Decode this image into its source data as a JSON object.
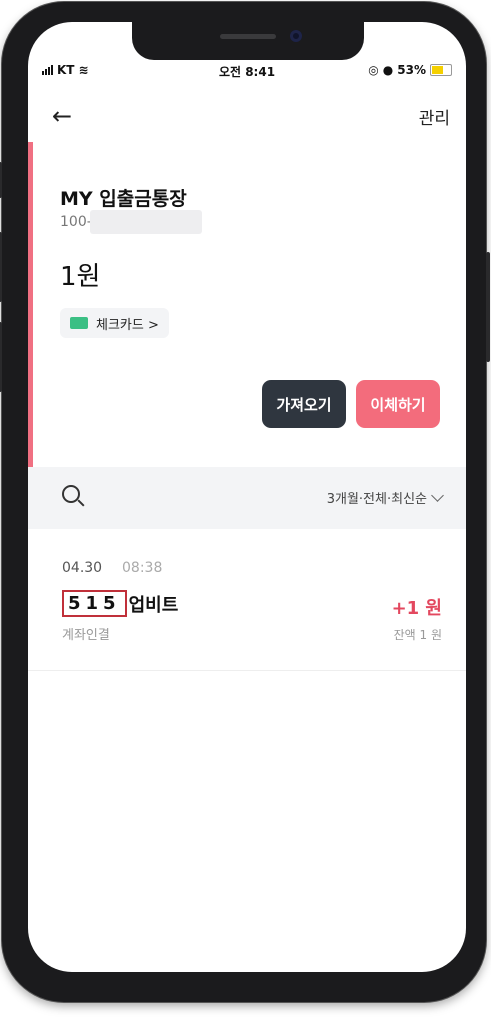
{
  "status": {
    "carrier": "KT",
    "time": "오전 8:41",
    "battery": "53%"
  },
  "header": {
    "back_icon": "arrow-left-icon",
    "manage_label": "관리"
  },
  "account": {
    "name": "MY 입출금통장",
    "number_prefix": "100-",
    "balance": "1원",
    "card_chip": "체크카드 >",
    "fetch_label": "가져오기",
    "transfer_label": "이체하기",
    "accent_color": "#f07082"
  },
  "filter": {
    "label": "3개월·전체·최신순"
  },
  "transaction": {
    "date": "04.30",
    "time": "08:38",
    "code": "515",
    "name": "업비트",
    "sub": "계좌인결",
    "amount": "+1 원",
    "balance": "잔액 1 원"
  }
}
